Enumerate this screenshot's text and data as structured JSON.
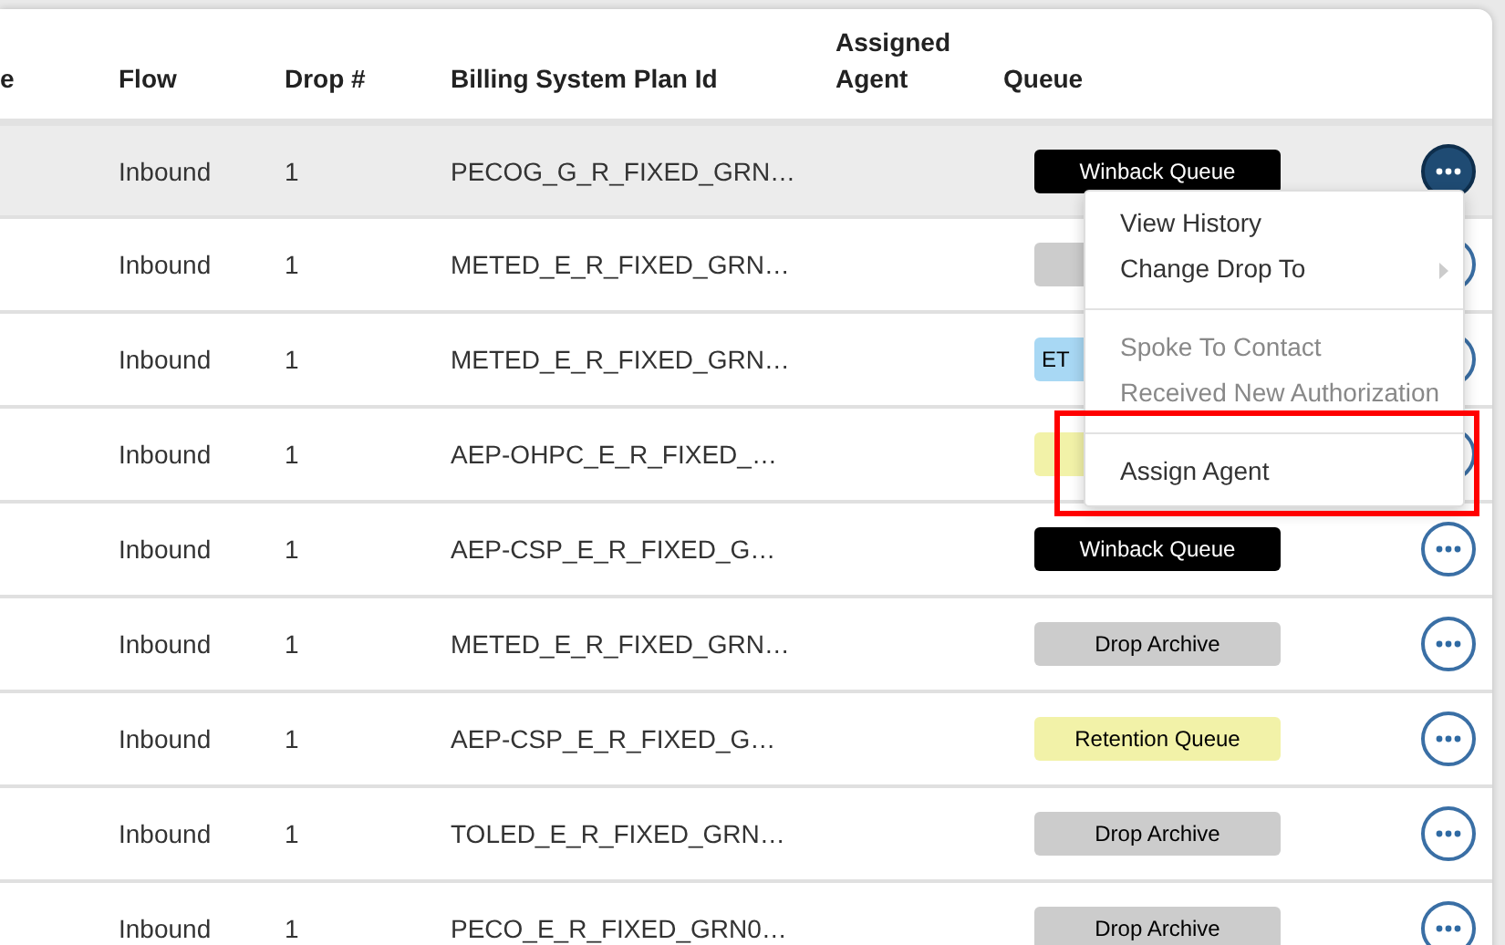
{
  "table": {
    "columns": [
      "e",
      "Flow",
      "Drop #",
      "Billing System Plan Id",
      "Assigned Agent",
      "Queue"
    ],
    "rows": [
      {
        "selected": true,
        "flow": "Inbound",
        "drop": "1",
        "plan": "PECOG_G_R_FIXED_GRN…",
        "queue": {
          "label": "Winback Queue",
          "color": "#000000"
        }
      },
      {
        "selected": false,
        "flow": "Inbound",
        "drop": "1",
        "plan": "METED_E_R_FIXED_GRN…",
        "queue": {
          "color": "#cccccc"
        }
      },
      {
        "selected": false,
        "flow": "Inbound",
        "drop": "1",
        "plan": "METED_E_R_FIXED_GRN…",
        "queue": {
          "label": "ET",
          "color": "#a8d8f4",
          "cut": true
        }
      },
      {
        "selected": false,
        "flow": "Inbound",
        "drop": "1",
        "plan": "AEP-OHPC_E_R_FIXED_…",
        "queue": {
          "color": "#f2f2a8"
        }
      },
      {
        "selected": false,
        "flow": "Inbound",
        "drop": "1",
        "plan": "AEP-CSP_E_R_FIXED_G…",
        "queue": {
          "label": "Winback Queue",
          "color": "#000000"
        }
      },
      {
        "selected": false,
        "flow": "Inbound",
        "drop": "1",
        "plan": "METED_E_R_FIXED_GRN…",
        "queue": {
          "label": "Drop Archive",
          "color": "#cccccc"
        }
      },
      {
        "selected": false,
        "flow": "Inbound",
        "drop": "1",
        "plan": "AEP-CSP_E_R_FIXED_G…",
        "queue": {
          "label": "Retention Queue",
          "color": "#f2f2a8"
        }
      },
      {
        "selected": false,
        "flow": "Inbound",
        "drop": "1",
        "plan": "TOLED_E_R_FIXED_GRN…",
        "queue": {
          "label": "Drop Archive",
          "color": "#cccccc"
        }
      },
      {
        "selected": false,
        "flow": "Inbound",
        "drop": "1",
        "plan": "PECO_E_R_FIXED_GRN0…",
        "queue": {
          "label": "Drop Archive",
          "color": "#cccccc"
        }
      }
    ]
  },
  "menu": {
    "items": [
      {
        "kind": "item",
        "label": "View History",
        "disabled": false,
        "submenu": false,
        "highlighted": false
      },
      {
        "kind": "item",
        "label": "Change Drop To",
        "disabled": false,
        "submenu": true,
        "highlighted": false
      },
      {
        "kind": "divider"
      },
      {
        "kind": "item",
        "label": "Spoke To Contact",
        "disabled": true,
        "submenu": false,
        "highlighted": false
      },
      {
        "kind": "item",
        "label": "Received New Authorization",
        "disabled": true,
        "submenu": false,
        "highlighted": false
      },
      {
        "kind": "divider"
      },
      {
        "kind": "item",
        "label": "Assign Agent",
        "disabled": false,
        "submenu": false,
        "highlighted": true
      }
    ]
  }
}
